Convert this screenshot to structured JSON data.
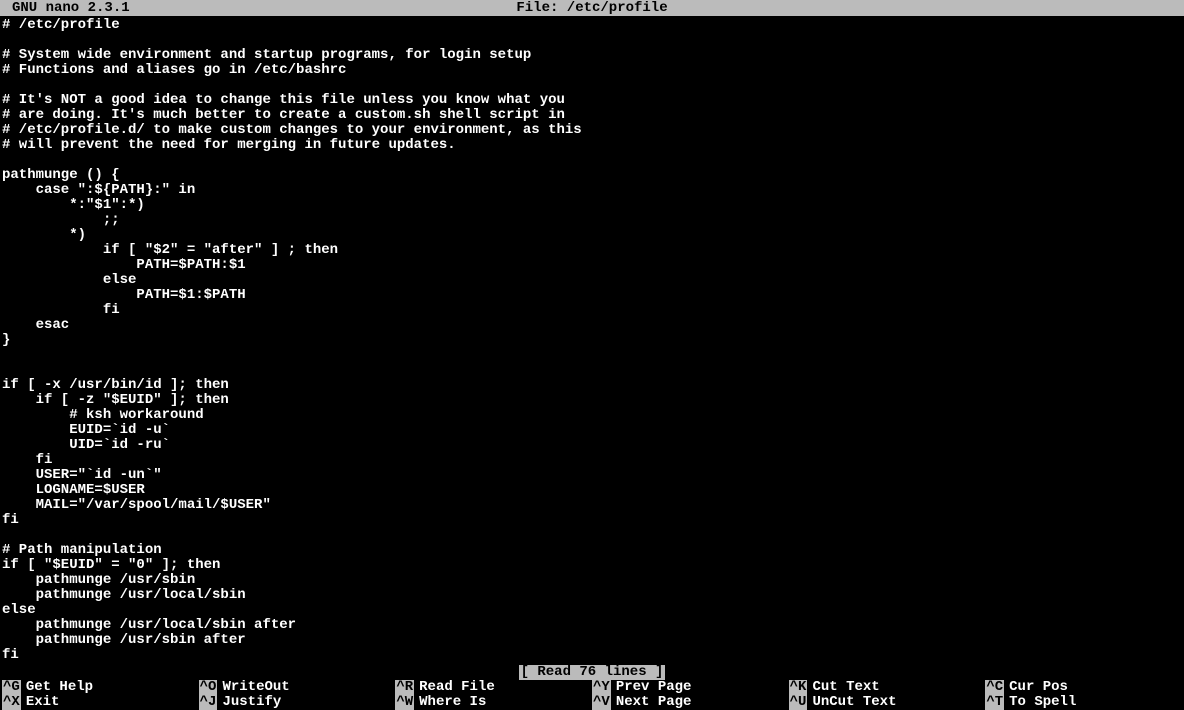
{
  "title": {
    "app": "GNU nano 2.3.1",
    "file_label": "File: /etc/profile"
  },
  "content": "# /etc/profile\n\n# System wide environment and startup programs, for login setup\n# Functions and aliases go in /etc/bashrc\n\n# It's NOT a good idea to change this file unless you know what you\n# are doing. It's much better to create a custom.sh shell script in\n# /etc/profile.d/ to make custom changes to your environment, as this\n# will prevent the need for merging in future updates.\n\npathmunge () {\n    case \":${PATH}:\" in\n        *:\"$1\":*)\n            ;;\n        *)\n            if [ \"$2\" = \"after\" ] ; then\n                PATH=$PATH:$1\n            else\n                PATH=$1:$PATH\n            fi\n    esac\n}\n\n\nif [ -x /usr/bin/id ]; then\n    if [ -z \"$EUID\" ]; then\n        # ksh workaround\n        EUID=`id -u`\n        UID=`id -ru`\n    fi\n    USER=\"`id -un`\"\n    LOGNAME=$USER\n    MAIL=\"/var/spool/mail/$USER\"\nfi\n\n# Path manipulation\nif [ \"$EUID\" = \"0\" ]; then\n    pathmunge /usr/sbin\n    pathmunge /usr/local/sbin\nelse\n    pathmunge /usr/local/sbin after\n    pathmunge /usr/sbin after\nfi",
  "status": "[ Read 76 lines ]",
  "shortcuts": [
    {
      "key": "^G",
      "label": "Get Help"
    },
    {
      "key": "^O",
      "label": "WriteOut"
    },
    {
      "key": "^R",
      "label": "Read File"
    },
    {
      "key": "^Y",
      "label": "Prev Page"
    },
    {
      "key": "^K",
      "label": "Cut Text"
    },
    {
      "key": "^C",
      "label": "Cur Pos"
    },
    {
      "key": "^X",
      "label": "Exit"
    },
    {
      "key": "^J",
      "label": "Justify"
    },
    {
      "key": "^W",
      "label": "Where Is"
    },
    {
      "key": "^V",
      "label": "Next Page"
    },
    {
      "key": "^U",
      "label": "UnCut Text"
    },
    {
      "key": "^T",
      "label": "To Spell"
    }
  ]
}
